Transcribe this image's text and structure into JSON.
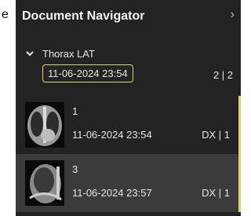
{
  "edge": {
    "char": "e"
  },
  "panel": {
    "title": "Document Navigator",
    "collapse_icon": "chevron-right-icon",
    "collapse_glyph": "›"
  },
  "group": {
    "expand_icon": "chevron-down-icon",
    "name": "Thorax LAT",
    "date": "11-06-2024 23:54",
    "count": "2 | 2"
  },
  "documents": [
    {
      "number": "1",
      "timestamp": "11-06-2024 23:54",
      "modality": "DX | 1",
      "thumb": "xray-pa-thumbnail",
      "selected": false
    },
    {
      "number": "3",
      "timestamp": "11-06-2024 23:57",
      "modality": "DX | 1",
      "thumb": "xray-lateral-thumbnail",
      "selected": true
    }
  ],
  "colors": {
    "panel_bg": "#232323",
    "selected_bg": "#3b3b3b",
    "accent": "#d8d86a",
    "text": "#e6e6e6"
  }
}
